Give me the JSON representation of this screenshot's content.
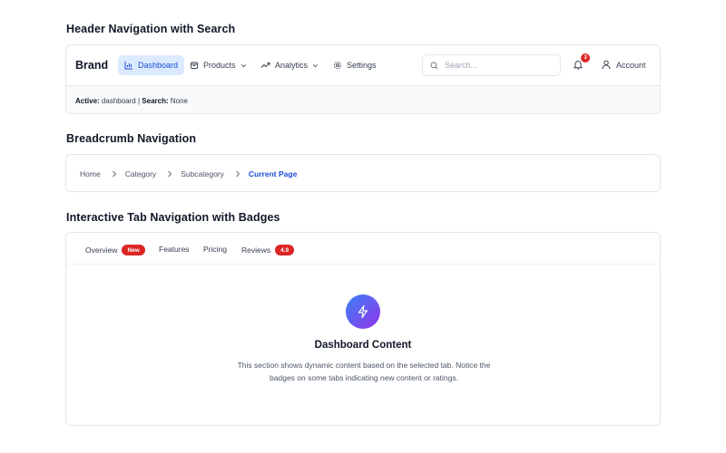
{
  "sections": {
    "header_title": "Header Navigation with Search",
    "breadcrumb_title": "Breadcrumb Navigation",
    "tabs_title": "Interactive Tab Navigation with Badges"
  },
  "header": {
    "brand": "Brand",
    "nav": [
      {
        "label": "Dashboard",
        "icon": "bar-chart-icon",
        "active": true
      },
      {
        "label": "Products",
        "icon": "package-icon",
        "dropdown": true
      },
      {
        "label": "Analytics",
        "icon": "trending-up-icon",
        "dropdown": true
      },
      {
        "label": "Settings",
        "icon": "gear-icon"
      }
    ],
    "search_placeholder": "Search...",
    "notification_count": "3",
    "account_label": "Account",
    "status": {
      "active_label": "Active:",
      "active_value": "dashboard",
      "separator": "|",
      "search_label": "Search:",
      "search_value": "None"
    }
  },
  "breadcrumb": {
    "items": [
      "Home",
      "Category",
      "Subcategory"
    ],
    "current": "Current Page"
  },
  "tabs": {
    "items": [
      {
        "label": "Overview",
        "badge": "New"
      },
      {
        "label": "Features"
      },
      {
        "label": "Pricing"
      },
      {
        "label": "Reviews",
        "badge": "4.9"
      }
    ],
    "content": {
      "icon": "lightning-icon",
      "title": "Dashboard Content",
      "description": "This section shows dynamic content based on the selected tab. Notice the badges on some tabs indicating new content or ratings."
    }
  },
  "colors": {
    "accent": "#1d4ed8",
    "active_bg": "#dbeafe",
    "badge": "#dc2626"
  }
}
